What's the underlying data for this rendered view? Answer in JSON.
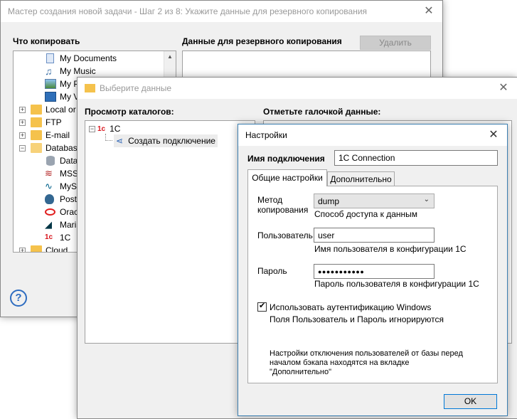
{
  "wizard": {
    "title": "Мастер создания новой задачи - Шаг 2 из 8: Укажите данные для резервного копирования",
    "left_header": "Что копировать",
    "right_header": "Данные для резервного копирования",
    "delete_button": "Удалить",
    "tree": [
      {
        "label": "My Documents",
        "icon": "document-icon"
      },
      {
        "label": "My Music",
        "icon": "music-icon"
      },
      {
        "label": "My P",
        "icon": "pictures-icon"
      },
      {
        "label": "My V",
        "icon": "video-icon"
      },
      {
        "label": "Local or",
        "icon": "folder-icon"
      },
      {
        "label": "FTP",
        "icon": "folder-icon"
      },
      {
        "label": "E-mail",
        "icon": "folder-icon"
      },
      {
        "label": "Database",
        "icon": "folder-icon"
      },
      {
        "label": "Datab",
        "icon": "database-icon"
      },
      {
        "label": "MSSQ",
        "icon": "mssql-icon"
      },
      {
        "label": "MySQ",
        "icon": "mysql-icon"
      },
      {
        "label": "Postg",
        "icon": "postgres-icon"
      },
      {
        "label": "Oracl",
        "icon": "oracle-icon"
      },
      {
        "label": "Maria",
        "icon": "mariadb-icon"
      },
      {
        "label": "1C",
        "icon": "1c-icon"
      },
      {
        "label": "Cloud",
        "icon": "folder-icon"
      }
    ]
  },
  "choose": {
    "title": "Выберите данные",
    "left_header": "Просмотр каталогов:",
    "right_header": "Отметьте галочкой данные:",
    "tree_root": "1С",
    "tree_child": "Создать подключение"
  },
  "settings": {
    "title": "Настройки",
    "connection_name_label": "Имя подключения",
    "connection_name_value": "1C Connection",
    "tab_general": "Общие настройки",
    "tab_advanced": "Дополнительно",
    "method_label_1": "Метод",
    "method_label_2": "копирования",
    "method_value": "dump",
    "method_hint": "Способ доступа к данным",
    "user_label": "Пользователь",
    "user_value": "user",
    "user_hint": "Имя пользователя в конфигурации 1С",
    "password_label": "Пароль",
    "password_value": "●●●●●●●●●●●",
    "password_hint": "Пароль пользователя в конфигурации 1С",
    "windows_auth_label": "Использовать аутентификацию Windows",
    "windows_auth_checked": true,
    "windows_auth_hint": "Поля Пользователь и Пароль игнорируются",
    "note_line1": "Настройки отключения пользователей от базы перед",
    "note_line2": "началом бэкапа находятся на вкладке",
    "note_line3": "\"Дополнительно\"",
    "ok_button": "OK"
  }
}
